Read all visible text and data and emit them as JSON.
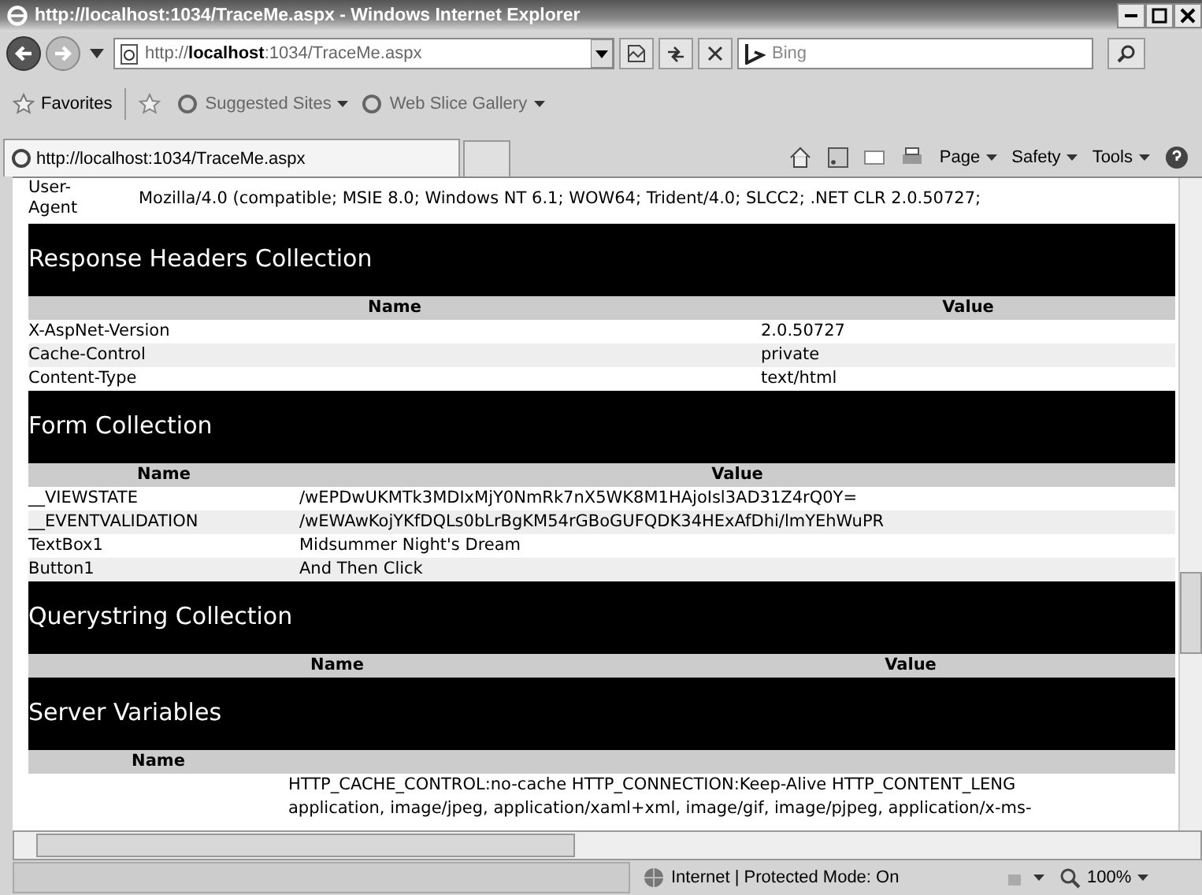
{
  "window": {
    "title": "http://localhost:1034/TraceMe.aspx - Windows Internet Explorer"
  },
  "address_bar": {
    "value": "http://**localhost**:1034/TraceMe.aspx"
  },
  "search": {
    "placeholder": "Bing"
  },
  "favorites_bar": {
    "favorites": "Favorites",
    "links": [
      "Suggested Sites",
      "Web Slice Gallery"
    ]
  },
  "tab": {
    "title": "http://localhost:1034/TraceMe.aspx"
  },
  "command_bar": [
    "Page",
    "Safety",
    "Tools"
  ],
  "user_agent": {
    "name": "User-Agent",
    "value": "Mozilla/4.0 (compatible; MSIE 8.0; Windows NT 6.1; WOW64; Trident/4.0; SLCC2; .NET CLR 2.0.50727;"
  },
  "sections": [
    {
      "kind": "headers",
      "title": "Response Headers Collection",
      "columns": [
        "Name",
        "Value"
      ],
      "rows": [
        {
          "name": "X-AspNet-Version",
          "value": "2.0.50727"
        },
        {
          "name": "Cache-Control",
          "value": "private"
        },
        {
          "name": "Content-Type",
          "value": "text/html"
        }
      ]
    },
    {
      "kind": "form",
      "title": "Form Collection",
      "columns": [
        "Name",
        "Value"
      ],
      "rows": [
        {
          "name": "__VIEWSTATE",
          "value": "/wEPDwUKMTk3MDIxMjY0NmRk7nX5WK8M1HAjoIsl3AD31Z4rQ0Y="
        },
        {
          "name": "__EVENTVALIDATION",
          "value": "/wEWAwKojYKfDQLs0bLrBgKM54rGBoGUFQDK34HExAfDhi/lmYEhWuPR"
        },
        {
          "name": "TextBox1",
          "value": "Midsummer Night's Dream"
        },
        {
          "name": "Button1",
          "value": "And Then Click"
        }
      ]
    },
    {
      "kind": "querystring",
      "title": "Querystring Collection",
      "columns": [
        "Name",
        "Value"
      ]
    },
    {
      "kind": "server",
      "title": "Server Variables",
      "columns": [
        "Name"
      ],
      "rows": [
        {
          "lines": [
            "HTTP_CACHE_CONTROL:no-cache HTTP_CONNECTION:Keep-Alive HTTP_CONTENT_LENG",
            "application, image/jpeg, application/xaml+xml, image/gif, image/pjpeg, application/x-ms-"
          ]
        }
      ]
    }
  ],
  "status_bar": {
    "zone": "Internet | Protected Mode: On",
    "zoom": "100%"
  }
}
